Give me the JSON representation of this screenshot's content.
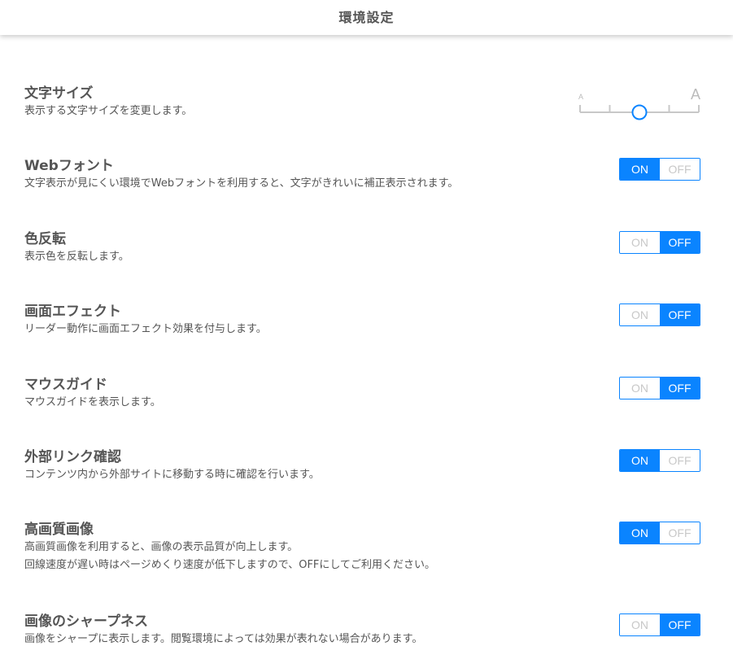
{
  "header": {
    "title": "環境設定"
  },
  "font_size": {
    "title": "文字サイズ",
    "desc": "表示する文字サイズを変更します。",
    "small_label": "A",
    "large_label": "A",
    "steps": 5,
    "selected_step": 3
  },
  "settings": [
    {
      "title": "Webフォント",
      "desc": [
        "文字表示が見にくい環境でWebフォントを利用すると、文字がきれいに補正表示されます。"
      ],
      "state": "ON"
    },
    {
      "title": "色反転",
      "desc": [
        "表示色を反転します。"
      ],
      "state": "OFF"
    },
    {
      "title": "画面エフェクト",
      "desc": [
        "リーダー動作に画面エフェクト効果を付与します。"
      ],
      "state": "OFF"
    },
    {
      "title": "マウスガイド",
      "desc": [
        "マウスガイドを表示します。"
      ],
      "state": "OFF"
    },
    {
      "title": "外部リンク確認",
      "desc": [
        "コンテンツ内から外部サイトに移動する時に確認を行います。"
      ],
      "state": "ON"
    },
    {
      "title": "高画質画像",
      "desc": [
        "高画質画像を利用すると、画像の表示品質が向上します。",
        "回線速度が遅い時はページめくり速度が低下しますので、OFFにしてご利用ください。"
      ],
      "state": "ON"
    },
    {
      "title": "画像のシャープネス",
      "desc": [
        "画像をシャープに表示します。閲覧環境によっては効果が表れない場合があります。"
      ],
      "state": "OFF"
    }
  ],
  "toggle_labels": {
    "on": "ON",
    "off": "OFF"
  },
  "colors": {
    "accent": "#0a84ff",
    "text": "#555555",
    "inactive": "#c8c8c8"
  }
}
